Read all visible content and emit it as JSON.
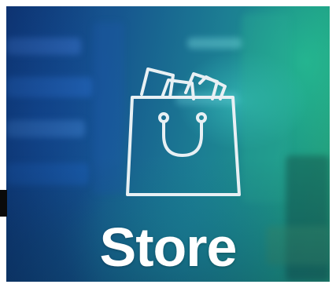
{
  "tile": {
    "label": "Store",
    "icon": "shopping-bag-icon"
  },
  "colors": {
    "label_text": "#ffffff",
    "icon_stroke": "#e8f0f4",
    "overlay_blue": "#16558f",
    "overlay_teal": "#1f9e87"
  }
}
